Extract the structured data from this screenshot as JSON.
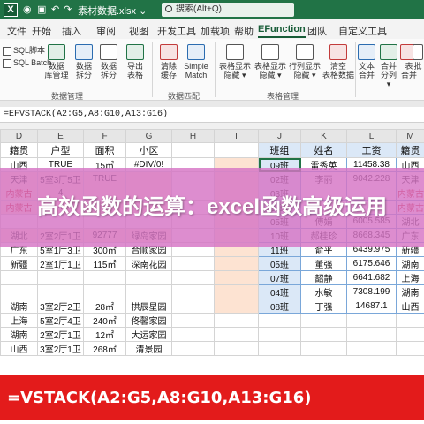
{
  "titlebar": {
    "app_logo": "X",
    "file_name": "素材数据.xlsx",
    "file_caret": "⌄",
    "search_placeholder": "搜索(Alt+Q)"
  },
  "tabs": [
    "文件",
    "开始",
    "插入",
    "审阅",
    "视图",
    "开发工具",
    "加载项",
    "帮助",
    "EFunction",
    "团队",
    "自定义工具"
  ],
  "active_tab": "EFunction",
  "ribbon": {
    "sql_items": [
      "SQL脚本",
      "SQL Batch"
    ],
    "group1_buttons": [
      {
        "line1": "数据",
        "line2": "库管理"
      },
      {
        "line1": "数据",
        "line2": "拆分"
      },
      {
        "line1": "数据",
        "line2": "拆分"
      },
      {
        "line1": "导出",
        "line2": "表格"
      }
    ],
    "group1_label": "数据管理",
    "group2_buttons": [
      {
        "line1": "清除",
        "line2": "缓存"
      },
      {
        "line1": "Simple",
        "line2": "Match"
      }
    ],
    "group2_label": "数据匹配",
    "group3_buttons": [
      {
        "line1": "表格显示",
        "line2": "隐藏 ▾"
      },
      {
        "line1": "表格显示",
        "line2": "隐藏 ▾"
      },
      {
        "line1": "行列显示",
        "line2": "隐藏 ▾"
      },
      {
        "line1": "清空",
        "line2": "表格数据"
      }
    ],
    "group3_label": "表格管理",
    "group4_buttons": [
      {
        "line1": "文本",
        "line2": "合并"
      },
      {
        "line1": "合并",
        "line2": "分列 ▾"
      },
      {
        "line1": "表",
        "line2": "合并"
      },
      {
        "line1": "批",
        "line2": ""
      }
    ]
  },
  "formula_bar": "=EFVSTACK(A2:G5,A8:G10,A13:G16)",
  "columns": [
    "D",
    "E",
    "F",
    "G",
    "H",
    "I",
    "J",
    "K",
    "L",
    "M"
  ],
  "left_rows": [
    [
      "籍贯",
      "户型",
      "面积",
      "小区"
    ],
    [
      "山西",
      "TRUE",
      "15㎡",
      "#DIV/0!"
    ],
    [
      "天津",
      "5室3厅5卫",
      "TRUE",
      ""
    ],
    [
      "内蒙古",
      "4",
      "",
      ""
    ],
    [
      "内蒙古",
      "4",
      "",
      ""
    ],
    [
      "",
      "",
      "",
      ""
    ],
    [
      "湖北",
      "2室2厅1卫",
      "92777",
      "绿岛家园"
    ],
    [
      "广东",
      "5室1厅3卫",
      "300㎡",
      "合顺家园"
    ],
    [
      "新疆",
      "2室1厅1卫",
      "115㎡",
      "深南花园"
    ],
    [
      "",
      "",
      "",
      ""
    ],
    [
      "",
      "",
      "",
      ""
    ],
    [
      "湖南",
      "3室2厅2卫",
      "28㎡",
      "拱辰星园"
    ],
    [
      "上海",
      "5室2厅4卫",
      "240㎡",
      "佟馨家园"
    ],
    [
      "湖南",
      "2室2厅1卫",
      "12㎡",
      "大运家园"
    ],
    [
      "山西",
      "3室2厅1卫",
      "268㎡",
      "清景园"
    ]
  ],
  "right_rows": [
    [
      "班组",
      "姓名",
      "工资",
      "籍贯"
    ],
    [
      "09班",
      "雷秀英",
      "11458.38",
      "山西"
    ],
    [
      "02班",
      "李丽",
      "9042.228",
      "天津"
    ],
    [
      "03班",
      "",
      "",
      "内蒙古"
    ],
    [
      "04班",
      "",
      "",
      "内蒙古"
    ],
    [
      "05班",
      "傅娟",
      "6005.585",
      "湖北"
    ],
    [
      "10班",
      "郝桂珍",
      "8668.345",
      "广东"
    ],
    [
      "11班",
      "俞平",
      "6439.975",
      "新疆"
    ],
    [
      "05班",
      "董强",
      "6175.646",
      "湖南"
    ],
    [
      "07班",
      "韶静",
      "6641.682",
      "上海"
    ],
    [
      "04班",
      "水敏",
      "7308.199",
      "湖南"
    ],
    [
      "08班",
      "丁强",
      "14687.1",
      "山西"
    ]
  ],
  "banner": "高效函数的运算：excel函数高级运用",
  "bottom_formula": "=VSTACK(A2:G5,A8:G10,A13:G16)"
}
